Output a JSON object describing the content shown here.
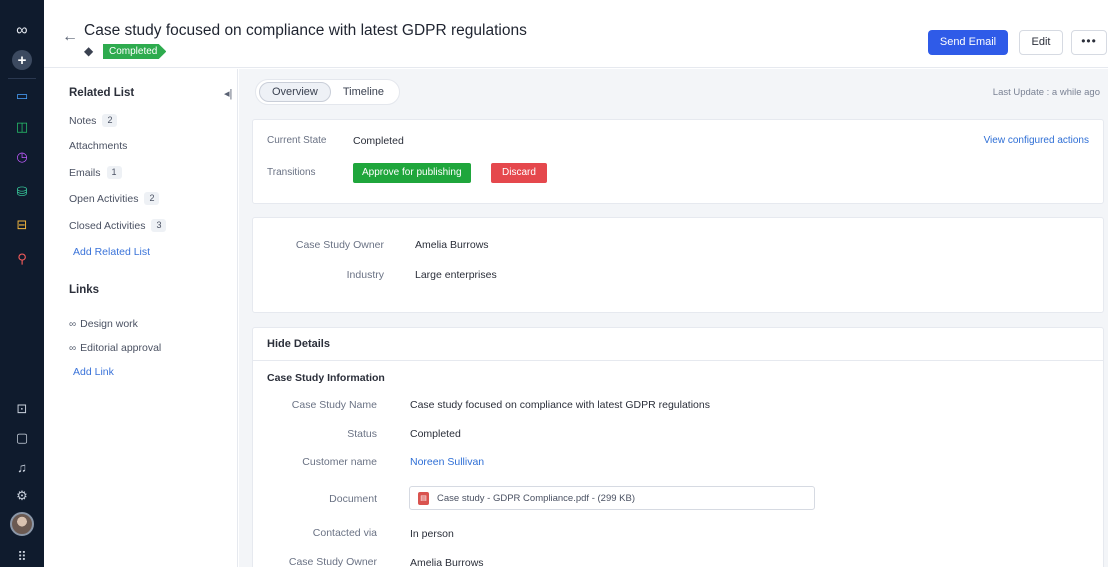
{
  "header": {
    "title": "Case study focused on compliance with latest GDPR regulations",
    "status": "Completed",
    "send_email": "Send Email",
    "edit": "Edit",
    "more": "•••"
  },
  "sidebar": {
    "related_heading": "Related List",
    "items": [
      {
        "label": "Notes",
        "count": "2"
      },
      {
        "label": "Attachments",
        "count": ""
      },
      {
        "label": "Emails",
        "count": "1"
      },
      {
        "label": "Open Activities",
        "count": "2"
      },
      {
        "label": "Closed Activities",
        "count": "3"
      }
    ],
    "add_related": "Add Related List",
    "links_heading": "Links",
    "links": [
      {
        "label": "Design work"
      },
      {
        "label": "Editorial approval"
      }
    ],
    "add_link": "Add Link"
  },
  "tabs": [
    {
      "label": "Overview",
      "active": true
    },
    {
      "label": "Timeline",
      "active": false
    }
  ],
  "last_update": "Last Update : a while ago",
  "state_card": {
    "current_state_label": "Current State",
    "current_state_value": "Completed",
    "transitions_label": "Transitions",
    "approve": "Approve for publishing",
    "discard": "Discard",
    "view_actions": "View configured actions"
  },
  "summary_card": {
    "owner_label": "Case Study Owner",
    "owner_value": "Amelia Burrows",
    "industry_label": "Industry",
    "industry_value": "Large enterprises"
  },
  "details": {
    "hide_details": "Hide Details",
    "section_title": "Case Study Information",
    "name_label": "Case Study Name",
    "name_value": "Case study focused on compliance with latest GDPR regulations",
    "status_label": "Status",
    "status_value": "Completed",
    "customer_label": "Customer name",
    "customer_value": "Noreen Sullivan",
    "document_label": "Document",
    "document_value": "Case study - GDPR Compliance.pdf - (299 KB)",
    "contacted_label": "Contacted via",
    "contacted_value": "In person",
    "owner_label": "Case Study Owner",
    "owner_value": "Amelia Burrows"
  },
  "colors": {
    "rail": "#0f1b2d",
    "primary": "#2f5be8",
    "success": "#1fa63c",
    "danger": "#e5484d",
    "link": "#2f6fd6"
  }
}
